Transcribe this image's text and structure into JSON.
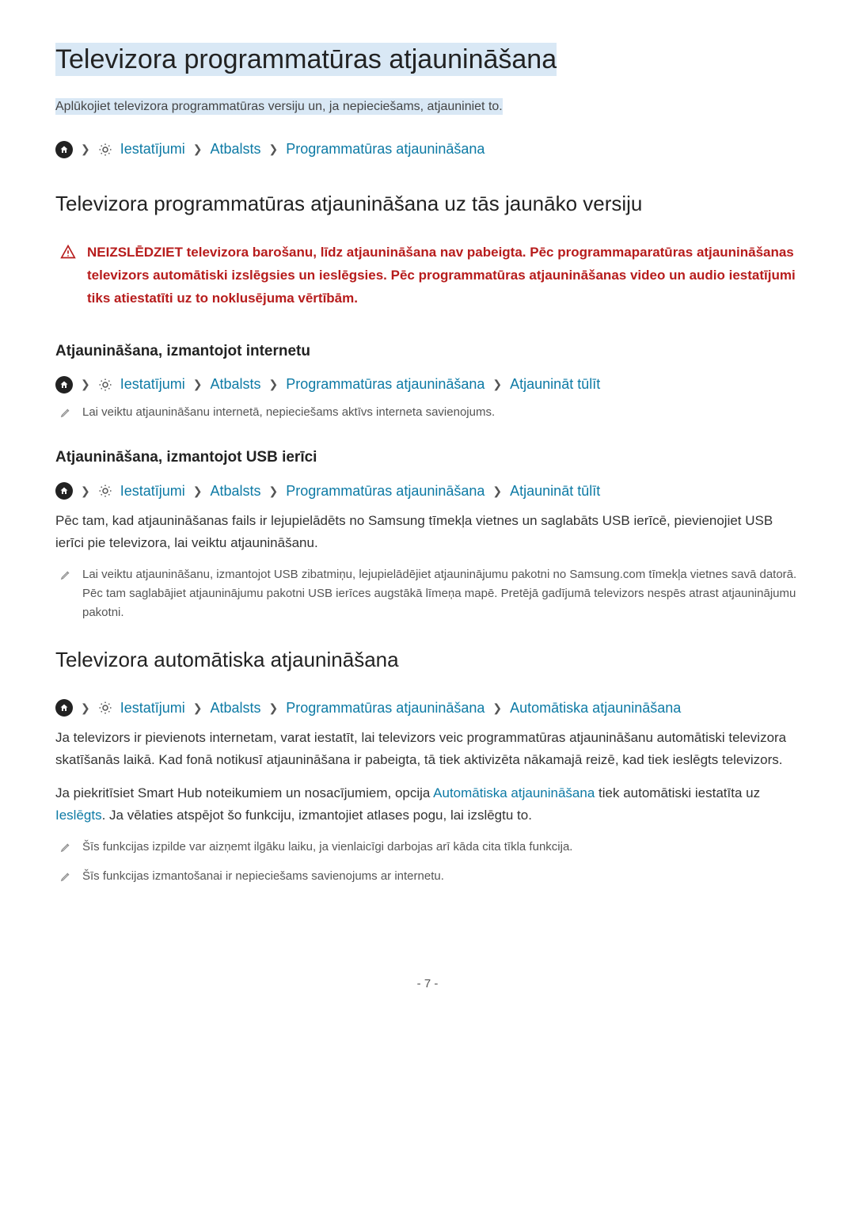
{
  "page": {
    "title": "Televizora programmatūras atjaunināšana",
    "subtitle": "Aplūkojiet televizora programmatūras versiju un, ja nepieciešams, atjauniniet to.",
    "number": "- 7 -"
  },
  "bc_main": {
    "s1": "Iestatījumi",
    "s2": "Atbalsts",
    "s3": "Programmatūras atjaunināšana"
  },
  "sec1": {
    "heading": "Televizora programmatūras atjaunināšana uz tās jaunāko versiju",
    "warning": "NEIZSLĒDZIET televizora barošanu, līdz atjaunināšana nav pabeigta. Pēc programmaparatūras atjaunināšanas televizors automātiski izslēgsies un ieslēgsies. Pēc programmatūras atjaunināšanas video un audio iestatījumi tiks atiestatīti uz to noklusējuma vērtībām."
  },
  "sec_internet": {
    "heading": "Atjaunināšana, izmantojot internetu",
    "bc": {
      "s1": "Iestatījumi",
      "s2": "Atbalsts",
      "s3": "Programmatūras atjaunināšana",
      "s4": "Atjaunināt tūlīt"
    },
    "note": "Lai veiktu atjaunināšanu internetā, nepieciešams aktīvs interneta savienojums."
  },
  "sec_usb": {
    "heading": "Atjaunināšana, izmantojot USB ierīci",
    "bc": {
      "s1": "Iestatījumi",
      "s2": "Atbalsts",
      "s3": "Programmatūras atjaunināšana",
      "s4": "Atjaunināt tūlīt"
    },
    "body": "Pēc tam, kad atjaunināšanas fails ir lejupielādēts no Samsung tīmekļa vietnes un saglabāts USB ierīcē, pievienojiet USB ierīci pie televizora, lai veiktu atjaunināšanu.",
    "note": "Lai veiktu atjaunināšanu, izmantojot USB zibatmiņu, lejupielādējiet atjauninājumu pakotni no Samsung.com tīmekļa vietnes savā datorā. Pēc tam saglabājiet atjauninājumu pakotni USB ierīces augstākā līmeņa mapē. Pretējā gadījumā televizors nespēs atrast atjauninājumu pakotni."
  },
  "sec_auto": {
    "heading": "Televizora automātiska atjaunināšana",
    "bc": {
      "s1": "Iestatījumi",
      "s2": "Atbalsts",
      "s3": "Programmatūras atjaunināšana",
      "s4": "Automātiska atjaunināšana"
    },
    "body1": "Ja televizors ir pievienots internetam, varat iestatīt, lai televizors veic programmatūras atjaunināšanu automātiski televizora skatīšanās laikā. Kad fonā notikusī atjaunināšana ir pabeigta, tā tiek aktivizēta nākamajā reizē, kad tiek ieslēgts televizors.",
    "body2_a": "Ja piekritīsiet Smart Hub noteikumiem un nosacījumiem, opcija ",
    "body2_link1": "Automātiska atjaunināšana",
    "body2_b": " tiek automātiski iestatīta uz ",
    "body2_link2": "Ieslēgts",
    "body2_c": ". Ja vēlaties atspējot šo funkciju, izmantojiet atlases pogu, lai izslēgtu to.",
    "note1": "Šīs funkcijas izpilde var aizņemt ilgāku laiku, ja vienlaicīgi darbojas arī kāda cita tīkla funkcija.",
    "note2": "Šīs funkcijas izmantošanai ir nepieciešams savienojums ar internetu."
  }
}
